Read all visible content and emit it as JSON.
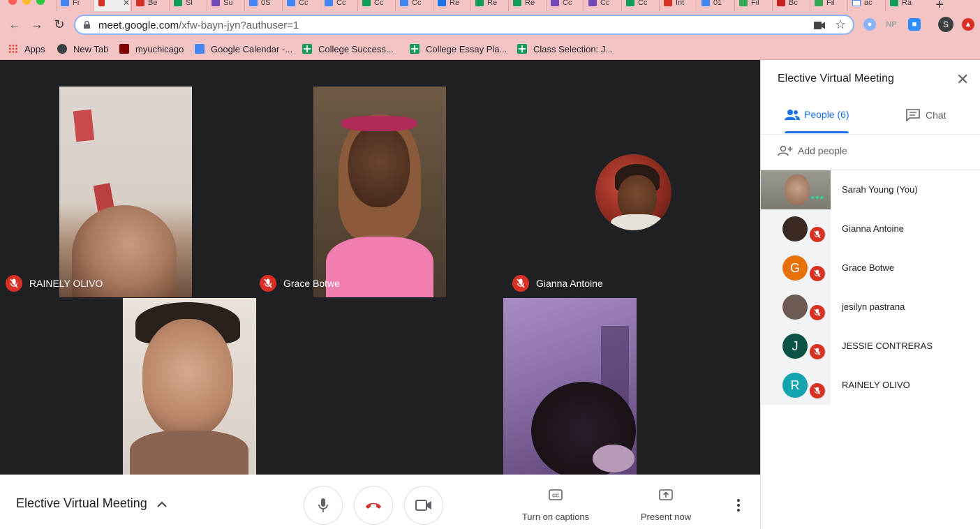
{
  "browser": {
    "tabs": [
      {
        "label": "Fr",
        "color": "#4285f4"
      },
      {
        "label": "",
        "color": "#d93025",
        "active": true
      },
      {
        "label": "Be",
        "color": "#d93025"
      },
      {
        "label": "Sl",
        "color": "#0f9d58"
      },
      {
        "label": "Su",
        "color": "#7248b9"
      },
      {
        "label": "0S",
        "color": "#4285f4"
      },
      {
        "label": "Cc",
        "color": "#4285f4"
      },
      {
        "label": "Cc",
        "color": "#4285f4"
      },
      {
        "label": "Cc",
        "color": "#0f9d58"
      },
      {
        "label": "Cc",
        "color": "#4285f4"
      },
      {
        "label": "Re",
        "color": "#1a73e8"
      },
      {
        "label": "Re",
        "color": "#0f9d58"
      },
      {
        "label": "Re",
        "color": "#0f9d58"
      },
      {
        "label": "Cc",
        "color": "#7248b9"
      },
      {
        "label": "Cc",
        "color": "#7248b9"
      },
      {
        "label": "Cc",
        "color": "#0f9d58"
      },
      {
        "label": "Int",
        "color": "#d93025"
      },
      {
        "label": "01",
        "color": "#4285f4"
      },
      {
        "label": "Fil",
        "color": "#34a853"
      },
      {
        "label": "Bc",
        "color": "#c5221f"
      },
      {
        "label": "Fil",
        "color": "#34a853"
      },
      {
        "label": "ac",
        "color": "#ffffff"
      },
      {
        "label": "Ra",
        "color": "#0f9d58"
      }
    ],
    "url_host": "meet.google.com",
    "url_path": "/xfw-bayn-jyn?authuser=1",
    "profile_initial": "S",
    "ext_np": "NP",
    "bookmarks": [
      {
        "label": "Apps",
        "icon": "apps-grid-icon",
        "color": "#4285f4"
      },
      {
        "label": "New Tab",
        "icon": "globe-icon",
        "color": "#3c4043"
      },
      {
        "label": "myuchicago",
        "icon": "shield-crest-icon",
        "color": "#800000"
      },
      {
        "label": "Google Calendar -...",
        "icon": "calendar-icon",
        "color": "#4285f4"
      },
      {
        "label": "College Success...",
        "icon": "sheets-icon",
        "color": "#0f9d58"
      },
      {
        "label": "College Essay Pla...",
        "icon": "sheets-icon",
        "color": "#0f9d58"
      },
      {
        "label": "Class Selection: J...",
        "icon": "sheets-icon",
        "color": "#0f9d58"
      }
    ]
  },
  "meeting": {
    "title": "Elective Virtual Meeting",
    "tiles": [
      {
        "name": "RAINELY OLIVO",
        "muted": true
      },
      {
        "name": "Grace Botwe",
        "muted": true
      },
      {
        "name": "Gianna Antoine",
        "muted": true
      },
      {
        "name": "",
        "muted": false
      },
      {
        "name": "",
        "muted": false
      }
    ],
    "controls": {
      "captions_label": "Turn on captions",
      "present_label": "Present now"
    }
  },
  "panel": {
    "title": "Elective Virtual Meeting",
    "people_tab": "People (6)",
    "chat_tab": "Chat",
    "add_people": "Add people",
    "participants": [
      {
        "name": "Sarah Young (You)",
        "initial": "",
        "avatar_color": "#8a8a7c",
        "muted": false,
        "speaking": true
      },
      {
        "name": "Gianna Antoine",
        "initial": "",
        "avatar_color": "#3a2a22",
        "muted": true
      },
      {
        "name": "Grace Botwe",
        "initial": "G",
        "avatar_color": "#e8710a",
        "muted": true
      },
      {
        "name": "jesilyn pastrana",
        "initial": "",
        "avatar_color": "#6d5a52",
        "muted": true
      },
      {
        "name": "JESSIE CONTRERAS",
        "initial": "J",
        "avatar_color": "#0b5345",
        "muted": true
      },
      {
        "name": "RAINELY OLIVO",
        "initial": "R",
        "avatar_color": "#12a4af",
        "muted": true
      }
    ]
  },
  "colors": {
    "accent": "#1a73e8",
    "mute_red": "#d93025",
    "chrome_bg": "#f4c3c3",
    "stage_bg": "#202124"
  }
}
